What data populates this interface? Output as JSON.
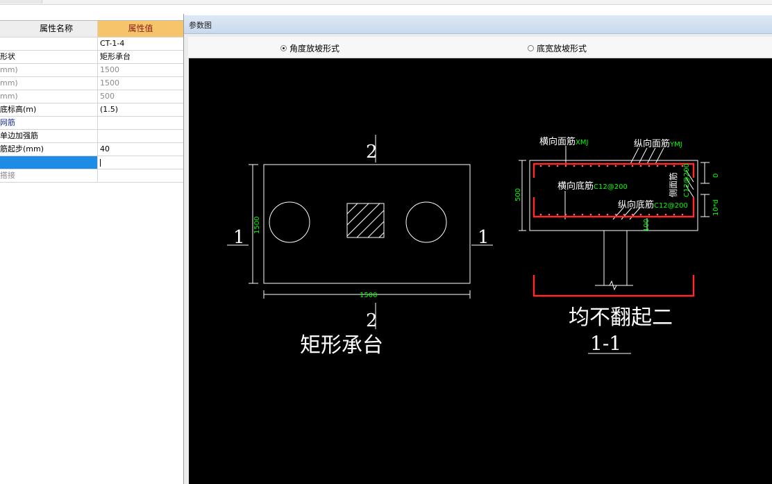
{
  "properties": {
    "header": {
      "name": "属性名称",
      "value": "属性值"
    },
    "rows": [
      {
        "name": "",
        "value": "CT-1-4"
      },
      {
        "name": "形状",
        "value": "矩形承台"
      },
      {
        "name": "mm)",
        "value": "1500"
      },
      {
        "name": "mm)",
        "value": "1500"
      },
      {
        "name": "mm)",
        "value": "500"
      },
      {
        "name": "底标高(m)",
        "value": "(1.5)"
      },
      {
        "name": "网筋",
        "value": ""
      },
      {
        "name": "单边加强筋",
        "value": ""
      },
      {
        "name": "筋起步(mm)",
        "value": "40"
      },
      {
        "name": "",
        "value": ""
      },
      {
        "name": "搭接",
        "value": ""
      }
    ]
  },
  "window": {
    "title": "参数图",
    "radio_options": [
      "角度放坡形式",
      "底宽放坡形式"
    ],
    "selected_option": "角度放坡形式"
  },
  "drawing": {
    "plan": {
      "section_top": "2",
      "section_bottom": "2",
      "section_left": "1",
      "section_right": "1",
      "dim_vertical": "1500",
      "dim_horizontal": "1500",
      "title": "矩形承台"
    },
    "section": {
      "label_top_transverse": "横向面筋",
      "code_top_transverse": "XMJ",
      "label_top_longitudinal": "纵向面筋",
      "code_top_longitudinal": "YMJ",
      "label_bottom_transverse": "横向底筋",
      "code_bottom_transverse": "C12@200",
      "label_bottom_longitudinal": "纵向底筋",
      "code_bottom_longitudinal": "C12@200",
      "label_side": "侧面筋",
      "code_side": "C12@200",
      "dim_height": "500",
      "dim_side": "10*d",
      "dim_embed": "100",
      "dim_right": "0",
      "caption": "均不翻起二",
      "section_name": "1-1"
    },
    "colors": {
      "line": "#ffffff",
      "dim": "#00ff00",
      "rebar": "#ff2a2a"
    }
  }
}
